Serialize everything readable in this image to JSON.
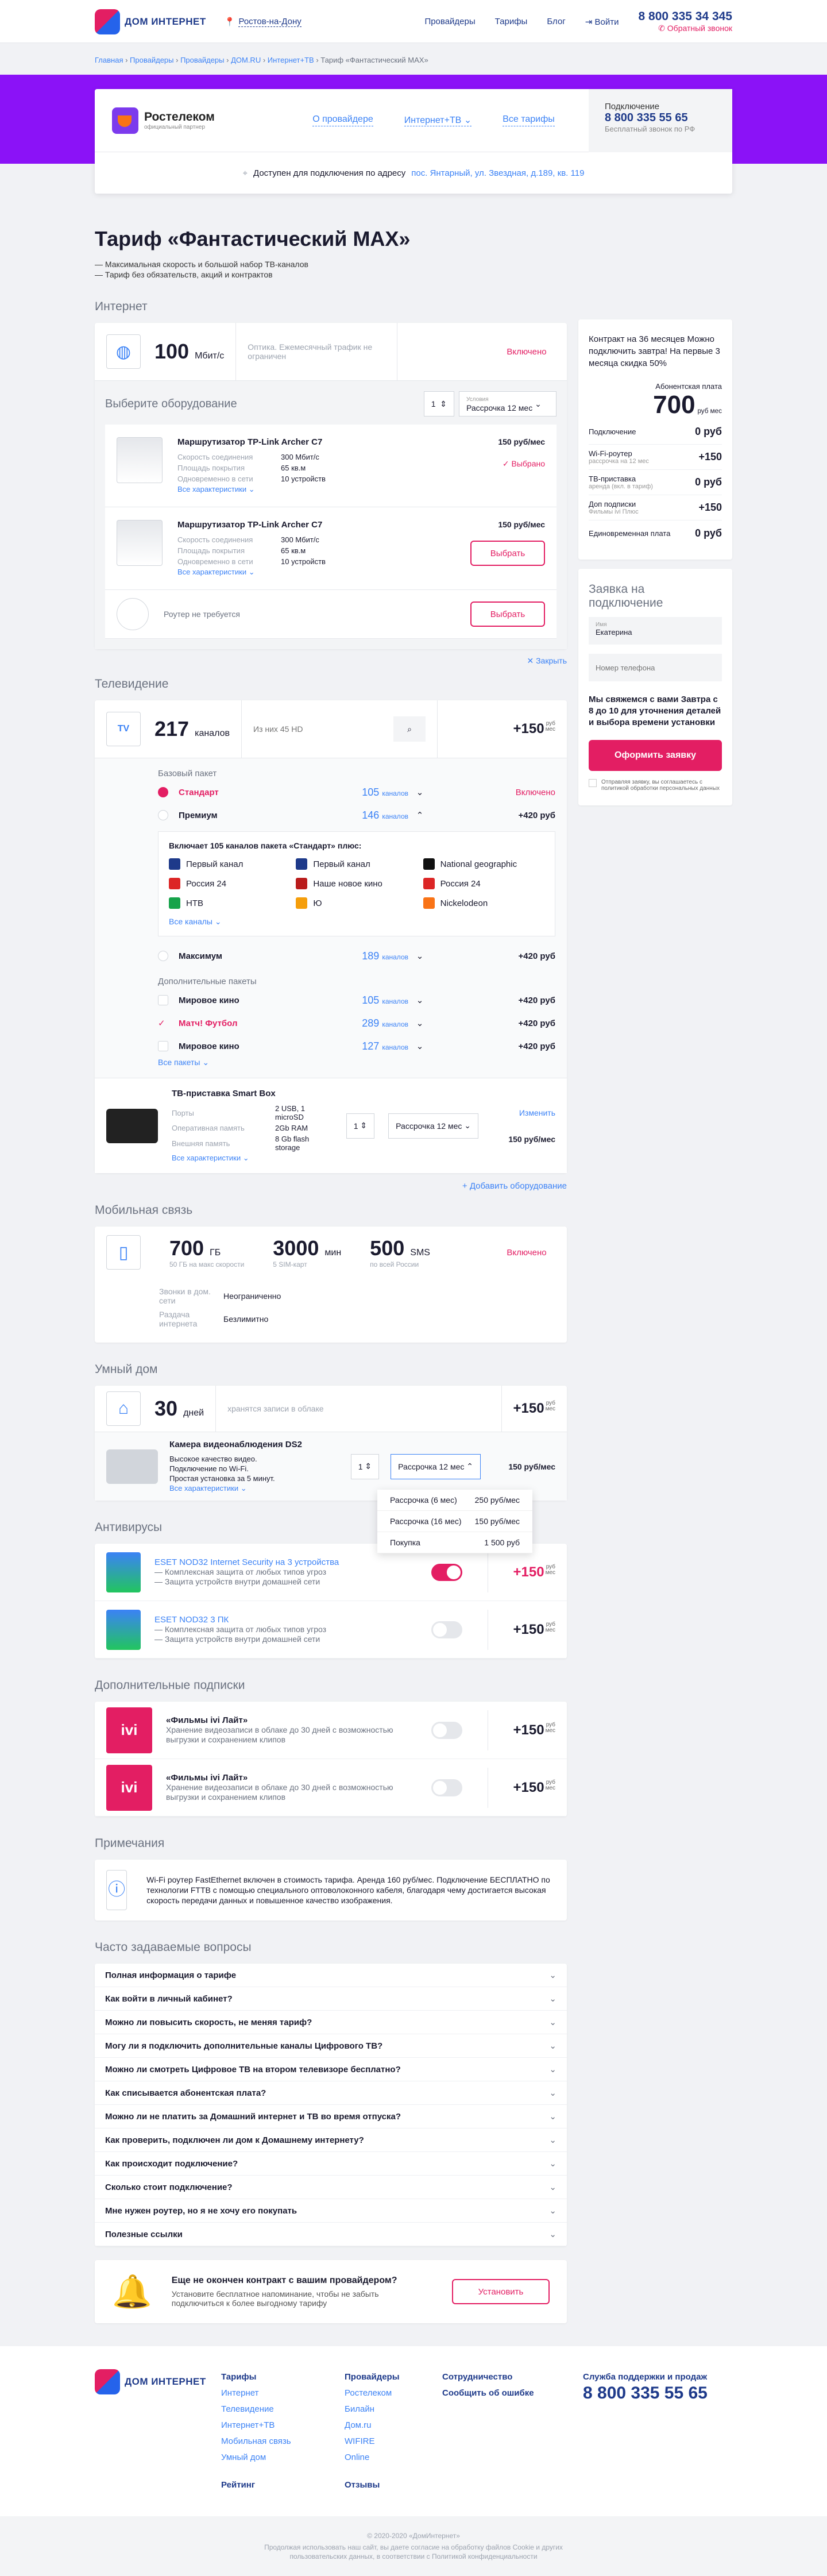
{
  "header": {
    "logo": "ДОМ ИНТЕРНЕТ",
    "city": "Ростов-на-Дону",
    "nav": [
      "Провайдеры",
      "Тарифы",
      "Блог"
    ],
    "login": "Войти",
    "phone": "8 800 335 34 345",
    "callback": "Обратный звонок"
  },
  "breadcrumbs": [
    "Главная",
    "Провайдеры",
    "Провайдеры",
    "ДОМ.RU",
    "Интернет+ТВ",
    "Тариф «Фантастический MAX»"
  ],
  "provider": {
    "name": "Ростелеком",
    "sub": "официальный партнер",
    "links": [
      "О провайдере",
      "Интернет+ТВ",
      "Все тарифы"
    ],
    "call_label": "Подключение",
    "call_phone": "8 800 335 55 65",
    "call_note": "Бесплатный звонок по РФ",
    "address_label": "Доступен для подключения по адресу",
    "address": "пос. Янтарный, ул. Звездная, д.189, кв. 119"
  },
  "title": "Тариф «Фантастический MAX»",
  "bullets": [
    "— Максимальная скорость и большой набор ТВ-каналов",
    "— Тариф без обязательств, акций и контрактов"
  ],
  "internet": {
    "section": "Интернет",
    "speed": "100",
    "unit": "Мбит/с",
    "desc": "Оптика. Ежемесячный трафик не ограничен",
    "status": "Включено",
    "equip_title": "Выберите оборудование",
    "qty": "1",
    "term_label": "Условия",
    "term": "Рассрочка 12 мес",
    "routers": [
      {
        "name": "Маршрутизатор TP-Link Archer C7",
        "k1": "Скорость соединения",
        "v1": "300 Мбит/с",
        "k2": "Площадь покрытия",
        "v2": "65 кв.м",
        "k3": "Одновременно в сети",
        "v3": "10 устройств",
        "more": "Все характеристики",
        "price": "150 руб/мес",
        "action": "Выбрано"
      },
      {
        "name": "Маршрутизатор TP-Link Archer C7",
        "k1": "Скорость соединения",
        "v1": "300 Мбит/с",
        "k2": "Площадь покрытия",
        "v2": "65 кв.м",
        "k3": "Одновременно в сети",
        "v3": "10 устройств",
        "more": "Все характеристики",
        "price": "150 руб/мес",
        "action": "Выбрать"
      }
    ],
    "no_router": "Роутер не требуется",
    "no_router_btn": "Выбрать",
    "close": "Закрыть"
  },
  "tv": {
    "section": "Телевидение",
    "channels": "217",
    "unit": "каналов",
    "search_placeholder": "Из них 45 HD",
    "price": "+150",
    "base_title": "Базовый пакет",
    "packages": [
      {
        "name": "Стандарт",
        "ch": "105",
        "price": "Включено"
      },
      {
        "name": "Премиум",
        "ch": "146",
        "price": "+420 руб"
      }
    ],
    "incl_title": "Включает 105 каналов пакета «Стандарт» плюс:",
    "incl": [
      "Первый канал",
      "Первый канал",
      "National geographic",
      "Россия 24",
      "Наше новое кино",
      "Россия 24",
      "НТВ",
      "Ю",
      "Nickelodeon"
    ],
    "all_ch": "Все каналы",
    "maximum": {
      "name": "Максимум",
      "ch": "189",
      "price": "+420 руб"
    },
    "extra_title": "Дополнительные пакеты",
    "extras": [
      {
        "name": "Мировое кино",
        "ch": "105",
        "price": "+420 руб"
      },
      {
        "name": "Матч! Футбол",
        "ch": "289",
        "price": "+420 руб"
      },
      {
        "name": "Мировое кино",
        "ch": "127",
        "price": "+420 руб"
      }
    ],
    "all_pk": "Все пакеты",
    "ch_word": "каналов",
    "stb": {
      "name": "ТВ-приставка Smart Box",
      "k1": "Порты",
      "v1": "2 USB, 1 microSD",
      "k2": "Оперативная память",
      "v2": "2Gb RAM",
      "k3": "Внешняя память",
      "v3": "8 Gb flash storage",
      "more": "Все характеристики",
      "change": "Изменить",
      "qty": "1",
      "term": "Рассрочка 12 мес",
      "price": "150 руб/мес"
    },
    "add_eq": "Добавить оборудование"
  },
  "mobile": {
    "section": "Мобильная связь",
    "gb": "700",
    "gb_u": "ГБ",
    "gb_d": "50 ГБ на макс скорости",
    "min": "3000",
    "min_u": "мин",
    "min_d": "5 SIM-карт",
    "sms": "500",
    "sms_u": "SMS",
    "sms_d": "по всей России",
    "status": "Включено",
    "k1": "Звонки в дом. сети",
    "v1": "Неограниченно",
    "k2": "Раздача интернета",
    "v2": "Безлимитно"
  },
  "smart": {
    "section": "Умный дом",
    "days": "30",
    "days_u": "дней",
    "desc": "хранятся записи в облаке",
    "price": "+150",
    "cam": "Камера видеонаблюдения DS2",
    "cam_d": [
      "Высокое качество видео.",
      "Подключение по Wi-Fi.",
      "Простая установка за 5 минут."
    ],
    "more": "Все характеристики",
    "qty": "1",
    "term": "Рассрочка 12 мес",
    "cam_price": "150 руб/мес",
    "dd": [
      [
        "Рассрочка (6 мес)",
        "250 руб/мес"
      ],
      [
        "Рассрочка (16 мес)",
        "150 руб/мес"
      ],
      [
        "Покупка",
        "1 500 руб"
      ]
    ]
  },
  "av": {
    "section": "Антивирусы",
    "items": [
      {
        "name": "ESET NOD32 Internet Security на 3 устройства",
        "d1": "— Комплексная защита от любых типов угроз",
        "d2": "— Защита устройств внутри домашней сети",
        "price": "+150"
      },
      {
        "name": "ESET NOD32 3 ПК",
        "d1": "— Комплексная защита от любых типов угроз",
        "d2": "— Защита устройств внутри домашней сети",
        "price": "+150"
      }
    ]
  },
  "subs": {
    "section": "Дополнительные подписки",
    "items": [
      {
        "name": "«Фильмы ivi Лайт»",
        "d": "Хранение видеозаписи в облаке до 30 дней с возможностью выгрузки и сохранением клипов",
        "price": "+150"
      },
      {
        "name": "«Фильмы ivi Лайт»",
        "d": "Хранение видеозаписи в облаке до 30 дней с возможностью выгрузки и сохранением клипов",
        "price": "+150"
      }
    ]
  },
  "notes": {
    "section": "Примечания",
    "text": "Wi-Fi роутер FastEthernet включен в стоимость тарифа. Аренда 160 руб/мес. Подключение БЕСПЛАТНО по технологии FTTB с помощью специального оптоволоконного кабеля, благодаря чему достигается высокая скорость передачи данных и повышенное качество изображения."
  },
  "faq": {
    "section": "Часто задаваемые вопросы",
    "items": [
      "Полная информация о тарифе",
      "Как войти в личный кабинет?",
      "Можно ли повысить скорость, не меняя тариф?",
      "Могу ли я подключить дополнительные каналы Цифрового ТВ?",
      "Можно ли смотреть Цифровое ТВ на втором телевизоре бесплатно?",
      "Как списывается абонентская плата?",
      "Можно ли не платить за Домашний интернет и ТВ во время отпуска?",
      "Как проверить, подключен ли дом к Домашнему интернету?",
      "Как происходит подключение?",
      "Сколько стоит подключение?",
      "Мне нужен роутер, но я не хочу его покупать",
      "Полезные ссылки"
    ]
  },
  "remind": {
    "title": "Еще не окончен контракт с вашим провайдером?",
    "text": "Установите бесплатное напоминание, чтобы не забыть подключиться к более выгодному тарифу",
    "btn": "Установить"
  },
  "summary": {
    "contract": "Контракт на 36 месяцев Можно подключить завтра! На первые 3 месяца скидка 50%",
    "fee_label": "Абонентская плата",
    "fee": "700",
    "fee_u": "руб мес",
    "rows": [
      [
        "Подключение",
        "",
        "0 руб"
      ],
      [
        "Wi-Fi-роутер",
        "рассрочка на 12 мес",
        "+150"
      ],
      [
        "ТВ-приставка",
        "аренда (вкл. в тариф)",
        "0 руб"
      ],
      [
        "Доп подписки",
        "Фильмы ivi Плюс",
        "+150"
      ],
      [
        "Единовременная плата",
        "",
        "0 руб"
      ]
    ]
  },
  "order": {
    "title": "Заявка на подключение",
    "name_label": "Имя",
    "name": "Екатерина",
    "phone_ph": "Номер телефона",
    "text": "Мы свяжемся с вами Завтра с 8 до 10 для уточнения деталей и выбора времени установки",
    "btn": "Оформить заявку",
    "agree": "Отправляя заявку, вы соглашаетесь с политикой обработки персональных данных"
  },
  "footer": {
    "logo": "ДОМ ИНТЕРНЕТ",
    "c1_h": "Тарифы",
    "c1": [
      "Интернет",
      "Телевидение",
      "Интернет+ТВ",
      "Мобильная связь",
      "Умный дом"
    ],
    "c2_h": "Провайдеры",
    "c2": [
      "Ростелеком",
      "Билайн",
      "Дом.ru",
      "WIFIRE",
      "Online"
    ],
    "c3": [
      "Сотрудничество",
      "Сообщить об ошибке"
    ],
    "rating": "Рейтинг",
    "reviews": "Отзывы",
    "sup_h": "Служба поддержки и продаж",
    "sup": "8 800 335 55 65",
    "copy": "© 2020-2020 «ДомИнтернет»",
    "legal": "Продолжая использовать наш сайт, вы даете согласие на обработку файлов Cookie и других пользовательских данных, в соответствии с Политикой конфиденциальности"
  }
}
